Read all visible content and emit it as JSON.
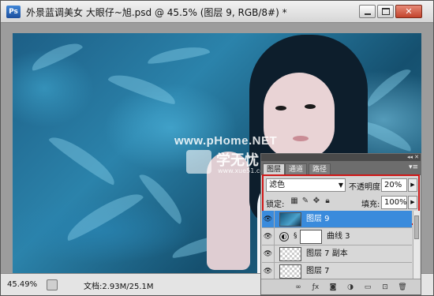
{
  "window": {
    "title": "外景蓝调美女  大眼仔~旭.psd @ 45.5% (图层 9, RGB/8#) *",
    "app_logo": "Ps",
    "buttons": {
      "minimize": "minimize-icon",
      "maximize": "maximize-icon",
      "close": "✕"
    }
  },
  "watermark": {
    "url_text": "www.pHome.NET",
    "brand_cn": "学无忧",
    "brand_url": "www.xue51.com"
  },
  "status": {
    "zoom": "45.49%",
    "doc_info": "文档:2.93M/25.1M"
  },
  "panel": {
    "tabs": [
      "图层",
      "通道",
      "路径"
    ],
    "blend_mode": "滤色",
    "opacity_label": "不透明度:",
    "opacity_value": "20%",
    "lock_label": "锁定:",
    "fill_label": "填充:",
    "fill_value": "100%",
    "layers": [
      {
        "name": "图层 9",
        "selected": true,
        "visible": true,
        "type": "pixel"
      },
      {
        "name": "曲线 3",
        "selected": false,
        "visible": true,
        "type": "adjustment"
      },
      {
        "name": "图层 7 副本",
        "selected": false,
        "visible": true,
        "type": "pixel"
      },
      {
        "name": "图层 7",
        "selected": false,
        "visible": true,
        "type": "pixel"
      }
    ],
    "footer_icons": [
      "link-icon",
      "fx-icon",
      "mask-icon",
      "adjustment-icon",
      "group-icon",
      "new-layer-icon",
      "trash-icon"
    ]
  },
  "colors": {
    "selection": "#3a8bdc",
    "highlight_box": "#d01818"
  }
}
